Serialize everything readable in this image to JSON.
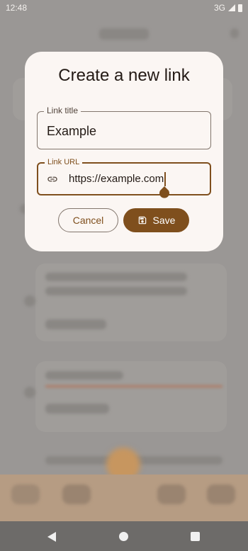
{
  "status_bar": {
    "time": "12:48",
    "network": "3G"
  },
  "dialog": {
    "title": "Create a new link",
    "title_field": {
      "label": "Link title",
      "value": "Example"
    },
    "url_field": {
      "label": "Link URL",
      "value": "https://example.com",
      "icon": "link-icon"
    },
    "buttons": {
      "cancel": "Cancel",
      "save": "Save",
      "save_icon": "save-icon"
    }
  },
  "colors": {
    "primary": "#7f4f1d",
    "surface": "#fbf6f3",
    "outline": "#82766d"
  }
}
